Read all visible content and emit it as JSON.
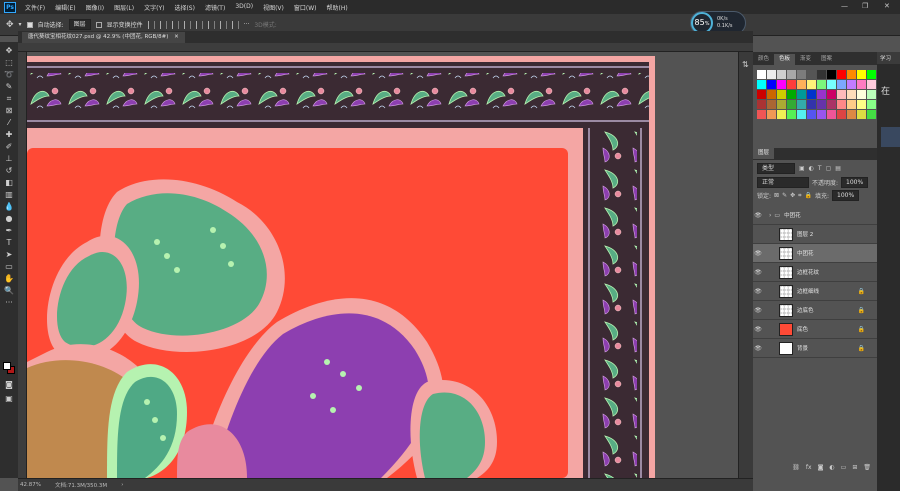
{
  "app": {
    "logo": "Ps"
  },
  "menu": [
    "文件(F)",
    "编辑(E)",
    "图像(I)",
    "图层(L)",
    "文字(Y)",
    "选择(S)",
    "滤镜(T)",
    "3D(D)",
    "视图(V)",
    "窗口(W)",
    "帮助(H)"
  ],
  "window_controls": [
    "—",
    "❐",
    "✕"
  ],
  "options": {
    "auto_select_label": "自动选择:",
    "auto_select_value": "图层",
    "show_transform_label": "显示变换控件",
    "mode3d_label": "3D模式:"
  },
  "gauge": {
    "percent": "85",
    "unit": "%",
    "net_up": "0K/s",
    "net_down": "0.1K/s"
  },
  "document": {
    "tab_title": "唐代葵纹宝相花纹027.psd @ 42.9% (中团花, RGB/8#)"
  },
  "status": {
    "zoom": "42.87%",
    "doc_info": "文档:71.3M/350.3M"
  },
  "swatches_panel": {
    "tabs": [
      "颜色",
      "色板",
      "渐变",
      "图案"
    ],
    "active": 1
  },
  "edge_panel": {
    "tab": "学习",
    "text": "在"
  },
  "layers_panel": {
    "tab": "图层",
    "kind_label": "类型",
    "blend_mode": "正常",
    "opacity_label": "不透明度:",
    "opacity_value": "100%",
    "lock_label": "锁定:",
    "fill_label": "填充:",
    "fill_value": "100%",
    "layers": [
      {
        "name": "中团花",
        "type": "group",
        "visible": true
      },
      {
        "name": "图层 2",
        "type": "layer",
        "visible": false
      },
      {
        "name": "中团花",
        "type": "layer",
        "visible": true,
        "selected": true
      },
      {
        "name": "边框花纹",
        "type": "layer",
        "visible": true
      },
      {
        "name": "边框细线",
        "type": "layer",
        "visible": true,
        "locked": true
      },
      {
        "name": "边底色",
        "type": "layer",
        "visible": true,
        "locked": true
      },
      {
        "name": "底色",
        "type": "layer",
        "visible": true,
        "locked": true
      },
      {
        "name": "背景",
        "type": "layer",
        "visible": true,
        "locked": true
      }
    ]
  },
  "colors": {
    "bg_red": "#ff4a36",
    "border_dark": "#3b2a33",
    "border_pink": "#f4a6a4",
    "green": "#58ad84",
    "purple": "#8d3fb0",
    "mint": "#b6f2b0"
  }
}
